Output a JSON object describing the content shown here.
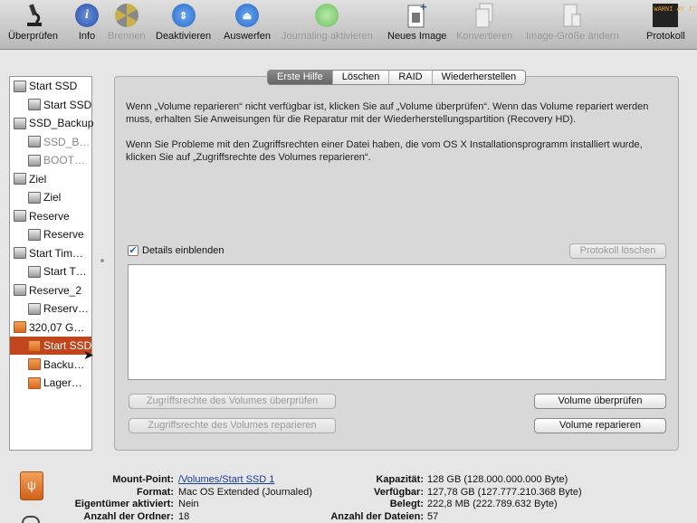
{
  "toolbar": {
    "items": [
      {
        "label": "Überprüfen",
        "icon": "microscope-icon",
        "enabled": true
      },
      {
        "label": "Info",
        "icon": "info-icon",
        "enabled": true
      },
      {
        "label": "Brennen",
        "icon": "burn-icon",
        "enabled": false
      },
      {
        "label": "Deaktivieren",
        "icon": "unmount-icon",
        "enabled": true
      },
      {
        "label": "Auswerfen",
        "icon": "eject-icon",
        "enabled": true
      },
      {
        "label": "Journaling aktivieren",
        "icon": "journaling-icon",
        "enabled": false
      },
      {
        "label": "Neues Image",
        "icon": "new-image-icon",
        "enabled": true
      },
      {
        "label": "Konvertieren",
        "icon": "convert-icon",
        "enabled": false
      },
      {
        "label": "Image-Größe ändern",
        "icon": "resize-image-icon",
        "enabled": false
      },
      {
        "label": "Protokoll",
        "icon": "log-icon",
        "enabled": true
      }
    ],
    "log_icon_text": "WARNI AY 7:36"
  },
  "sidebar": {
    "items": [
      {
        "label": "Start SSD",
        "level": 0,
        "type": "disk"
      },
      {
        "label": "Start SSD",
        "level": 1,
        "type": "disk"
      },
      {
        "label": "SSD_Backup",
        "level": 0,
        "type": "disk"
      },
      {
        "label": "SSD_B…",
        "level": 1,
        "type": "disk",
        "dim": true
      },
      {
        "label": "BOOT…",
        "level": 1,
        "type": "disk",
        "dim": true
      },
      {
        "label": "Ziel",
        "level": 0,
        "type": "disk"
      },
      {
        "label": "Ziel",
        "level": 1,
        "type": "disk"
      },
      {
        "label": "Reserve",
        "level": 0,
        "type": "disk"
      },
      {
        "label": "Reserve",
        "level": 1,
        "type": "disk"
      },
      {
        "label": "Start Tim…",
        "level": 0,
        "type": "disk"
      },
      {
        "label": "Start T…",
        "level": 1,
        "type": "disk"
      },
      {
        "label": "Reserve_2",
        "level": 0,
        "type": "disk"
      },
      {
        "label": "Reserv…",
        "level": 1,
        "type": "disk"
      },
      {
        "label": "320,07 G…",
        "level": 0,
        "type": "usb"
      },
      {
        "label": "Start SSD",
        "level": 1,
        "type": "usb",
        "selected": true
      },
      {
        "label": "Backu…",
        "level": 1,
        "type": "usb"
      },
      {
        "label": "Lager…",
        "level": 1,
        "type": "usb"
      }
    ]
  },
  "tabs": [
    {
      "label": "Erste Hilfe",
      "active": true
    },
    {
      "label": "Löschen"
    },
    {
      "label": "RAID"
    },
    {
      "label": "Wiederherstellen"
    }
  ],
  "first_aid": {
    "para1": "Wenn „Volume reparieren“ nicht verfügbar ist, klicken Sie auf „Volume überprüfen“. Wenn das Volume repariert werden muss, erhalten Sie Anweisungen für die Reparatur mit der Wiederherstellungspartition (Recovery HD).",
    "para2": "Wenn Sie Probleme mit den Zugriffsrechten einer Datei haben, die vom OS X Installationsprogramm installiert wurde, klicken Sie auf „Zugriffsrechte des Volumes reparieren“.",
    "details_label": "Details einblenden",
    "details_checked": true,
    "clear_log": "Protokoll löschen",
    "verify_permissions": "Zugriffsrechte des Volumes überprüfen",
    "repair_permissions": "Zugriffsrechte des Volumes reparieren",
    "verify_volume": "Volume überprüfen",
    "repair_volume": "Volume reparieren"
  },
  "info": {
    "mount_point_label": "Mount-Point:",
    "mount_point": "/Volumes/Start SSD 1",
    "format_label": "Format:",
    "format": "Mac OS Extended (Journaled)",
    "owners_label": "Eigentümer aktiviert:",
    "owners": "Nein",
    "folders_label": "Anzahl der Ordner:",
    "folders": "18",
    "capacity_label": "Kapazität:",
    "capacity": "128 GB (128.000.000.000 Byte)",
    "available_label": "Verfügbar:",
    "available": "127,78 GB (127.777.210.368 Byte)",
    "used_label": "Belegt:",
    "used": "222,8 MB (222.789.632 Byte)",
    "files_label": "Anzahl der Dateien:",
    "files": "57"
  }
}
